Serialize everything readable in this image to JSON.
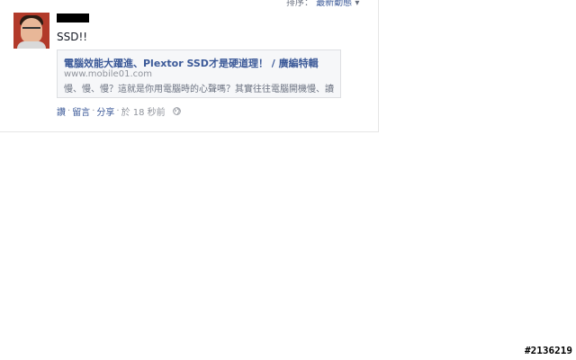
{
  "sort": {
    "label": "排序：",
    "value": "最新動態",
    "chevron": "▾"
  },
  "post": {
    "avatar_icon": "user-avatar",
    "text": "SSD!!",
    "link_card": {
      "title": "電腦效能大躍進、Plextor SSD才是硬道理！ / 廣編特輯",
      "domain": "www.mobile01.com",
      "description": "慢、慢、慢？這就是你用電腦時的心聲嗎？其實往往電腦開機慢、讀..."
    },
    "actions": {
      "like": "讚",
      "comment": "留言",
      "share": "分享",
      "separator": "·",
      "timestamp": "於 18 秒前",
      "privacy_icon": "globe-icon"
    }
  },
  "watermark": "#2136219",
  "colors": {
    "link": "#3b5998",
    "muted": "#90949c",
    "card_bg": "#f6f7f9",
    "card_border": "#dddfe2"
  }
}
